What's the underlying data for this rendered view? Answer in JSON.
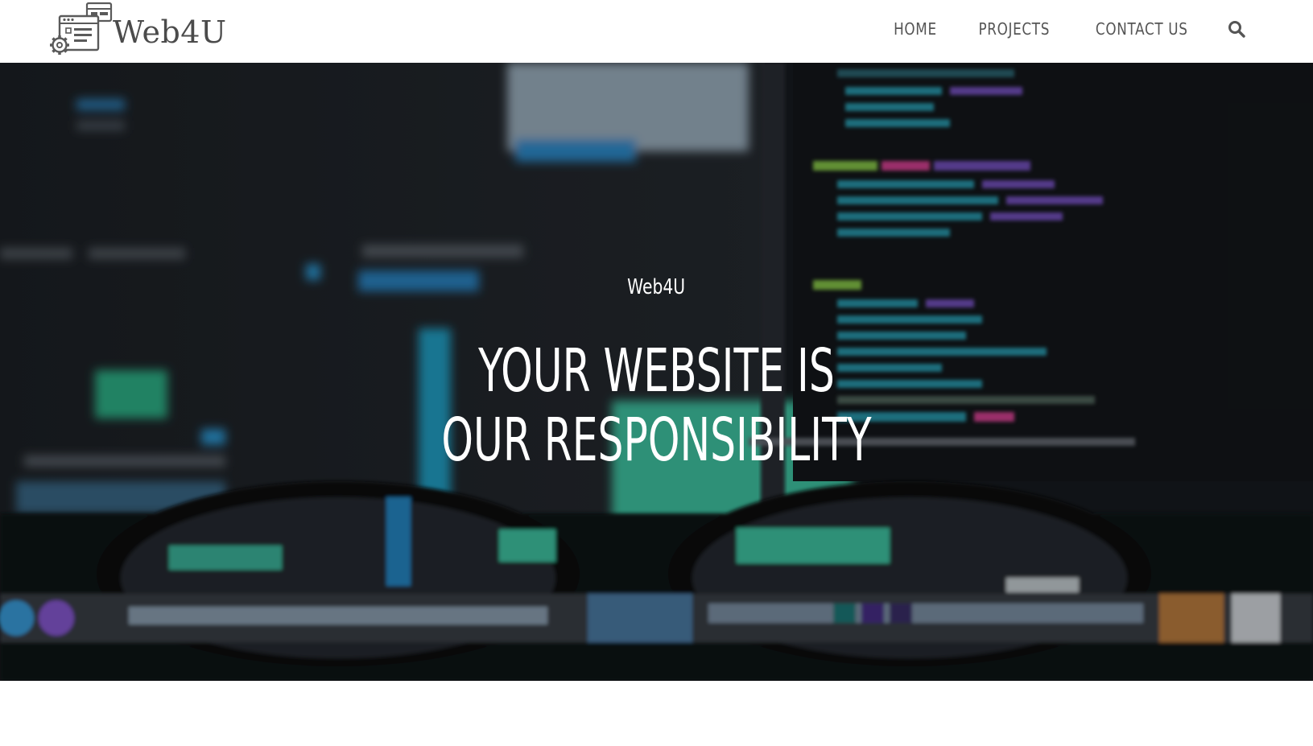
{
  "brand": {
    "name": "Web4U"
  },
  "nav": {
    "items": [
      {
        "label": "HOME"
      },
      {
        "label": "PROJECTS"
      },
      {
        "label": "CONTACT US"
      }
    ],
    "search_icon": "search-icon"
  },
  "hero": {
    "subtitle": "Web4U",
    "title_line1": "YOUR WEBSITE IS",
    "title_line2": "OUR RESPONSIBILITY",
    "background": "blurred photo of code on monitors seen through eyeglasses"
  },
  "colors": {
    "nav_text": "#555555",
    "logo_text": "#4b4b4b",
    "hero_text": "#ffffff"
  }
}
